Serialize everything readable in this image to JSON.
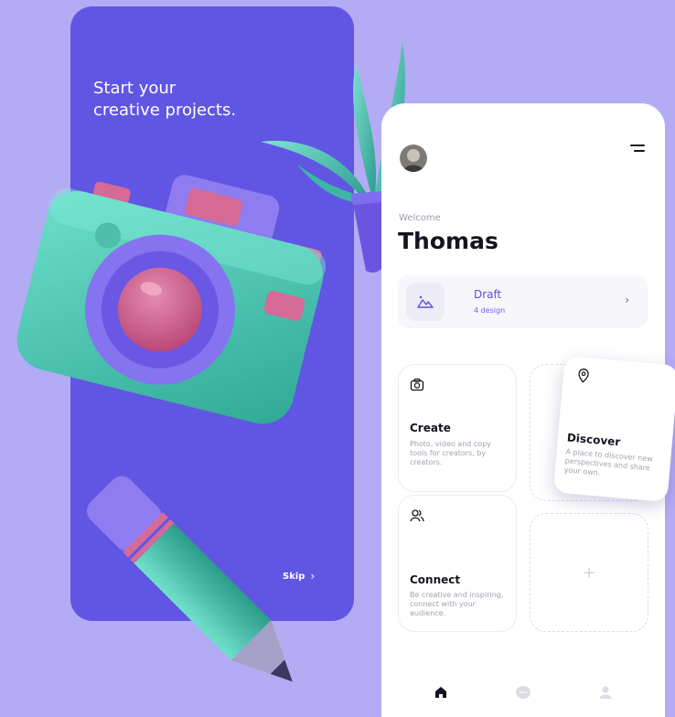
{
  "onboarding": {
    "headline": "Start your\ncreative projects.",
    "skip_label": "Skip"
  },
  "profile": {
    "welcome_label": "Welcome",
    "name": "Thomas"
  },
  "draft": {
    "title": "Draft",
    "count": "4 design"
  },
  "cards": {
    "create": {
      "title": "Create",
      "description": "Photo, video and copy tools for creators, by creators."
    },
    "discover": {
      "title": "Discover",
      "description": "A place to discover new perspectives and share your own."
    },
    "connect": {
      "title": "Connect",
      "description": "Be creative and inspiring, connect with your audience."
    },
    "add_symbol": "+"
  },
  "tabs": [
    "home-icon",
    "chat-icon",
    "profile-icon"
  ],
  "colors": {
    "background": "#b4abf5",
    "onboard_purple": "#6155e4",
    "accent": "#5b50e0",
    "teal": "#52c9b4",
    "pink": "#cf5f8c"
  }
}
